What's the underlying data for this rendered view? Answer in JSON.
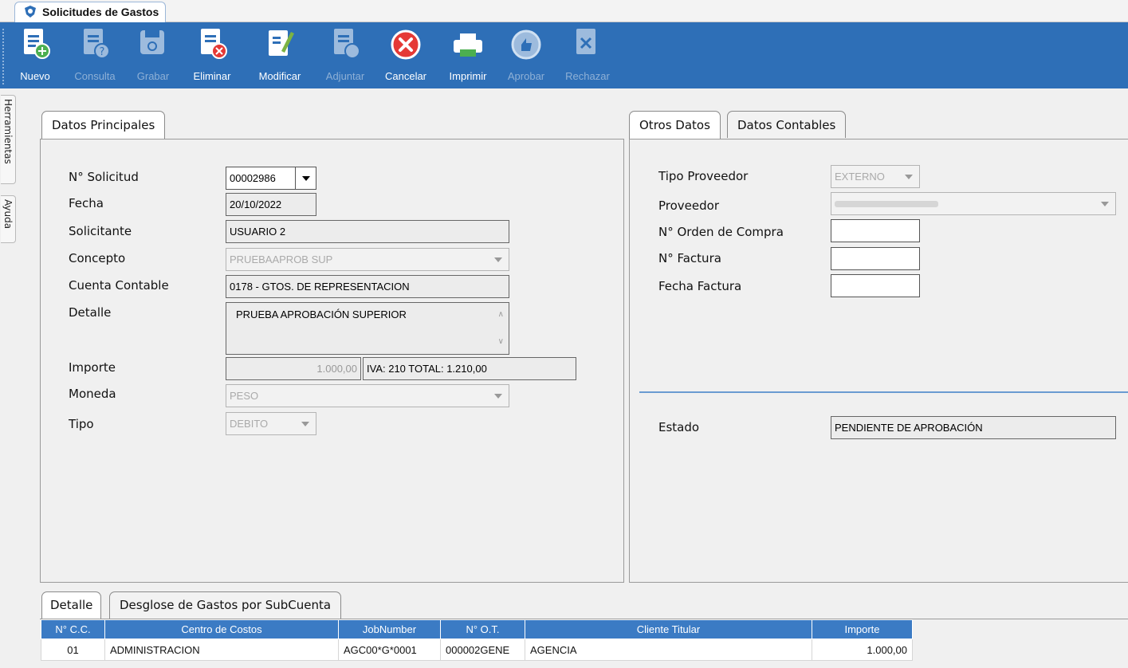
{
  "window": {
    "tab_title": "Solicitudes de Gastos"
  },
  "toolbar": {
    "buttons": [
      {
        "label": "Nuevo",
        "icon": "new-document-icon",
        "enabled": true
      },
      {
        "label": "Consulta",
        "icon": "query-document-icon",
        "enabled": false
      },
      {
        "label": "Grabar",
        "icon": "save-disk-icon",
        "enabled": false
      },
      {
        "label": "Eliminar",
        "icon": "delete-document-icon",
        "enabled": true
      },
      {
        "label": "Modificar",
        "icon": "edit-document-icon",
        "enabled": true
      },
      {
        "label": "Adjuntar",
        "icon": "attach-document-icon",
        "enabled": false
      },
      {
        "label": "Cancelar",
        "icon": "cancel-icon",
        "enabled": true
      },
      {
        "label": "Imprimir",
        "icon": "printer-icon",
        "enabled": true
      },
      {
        "label": "Aprobar",
        "icon": "approve-icon",
        "enabled": false
      },
      {
        "label": "Rechazar",
        "icon": "reject-icon",
        "enabled": false
      }
    ]
  },
  "side_tabs": {
    "tools": "Herramientas",
    "help": "Ayuda"
  },
  "main_panel": {
    "tab": "Datos Principales",
    "labels": {
      "solicitud": "N° Solicitud",
      "fecha": "Fecha",
      "solicitante": "Solicitante",
      "concepto": "Concepto",
      "cuenta": "Cuenta Contable",
      "detalle": "Detalle",
      "importe": "Importe",
      "moneda": "Moneda",
      "tipo": "Tipo"
    },
    "values": {
      "solicitud": "00002986",
      "fecha": "20/10/2022",
      "solicitante": "USUARIO 2",
      "concepto": "PRUEBAAPROB SUP",
      "cuenta": "0178 - GTOS. DE REPRESENTACION",
      "detalle": "PRUEBA APROBACIÓN SUPERIOR",
      "importe": "1.000,00",
      "iva_total": "IVA: 210 TOTAL:  1.210,00",
      "moneda": "PESO",
      "tipo": "DEBITO"
    }
  },
  "side_panel": {
    "tabs": [
      "Otros Datos",
      "Datos Contables"
    ],
    "labels": {
      "tipo_proveedor": "Tipo Proveedor",
      "proveedor": "Proveedor",
      "orden_compra": "N° Orden de Compra",
      "factura": "N° Factura",
      "fecha_factura": "Fecha Factura",
      "estado": "Estado"
    },
    "values": {
      "tipo_proveedor": "EXTERNO",
      "proveedor": "",
      "orden_compra": "",
      "factura": "",
      "fecha_factura": "",
      "estado": "PENDIENTE DE APROBACIÓN"
    }
  },
  "bottom": {
    "tabs": [
      "Detalle",
      "Desglose de Gastos por SubCuenta"
    ],
    "columns": [
      "N° C.C.",
      "Centro de Costos",
      "JobNumber",
      "N° O.T.",
      "Cliente Titular",
      "Importe"
    ],
    "rows": [
      [
        "01",
        "ADMINISTRACION",
        "AGC00*G*0001",
        "000002GENE",
        "AGENCIA",
        "1.000,00"
      ]
    ]
  },
  "colors": {
    "toolbar": "#2e6fb7",
    "grid_header": "#3b7bc4",
    "accent_line": "#6a9bd1"
  }
}
